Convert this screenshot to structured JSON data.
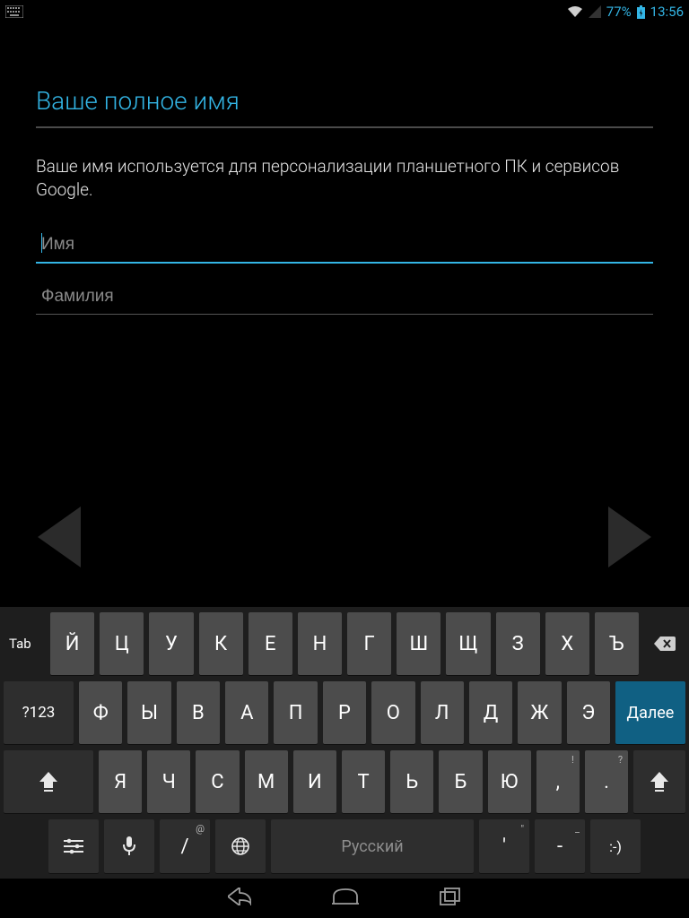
{
  "status": {
    "battery_pct": "77%",
    "clock": "13:56"
  },
  "form": {
    "title": "Ваше полное имя",
    "description": "Ваше имя используется для персонализации планшетного ПК и сервисов Google.",
    "first_name_placeholder": "Имя",
    "last_name_placeholder": "Фамилия",
    "first_name_value": "",
    "last_name_value": ""
  },
  "keyboard": {
    "tab": "Tab",
    "sym": "?123",
    "next": "Далее",
    "space": "Русский",
    "row1": [
      "Й",
      "Ц",
      "У",
      "К",
      "Е",
      "Н",
      "Г",
      "Ш",
      "Щ",
      "З",
      "Х",
      "Ъ"
    ],
    "row2": [
      "Ф",
      "Ы",
      "В",
      "А",
      "П",
      "Р",
      "О",
      "Л",
      "Д",
      "Ж",
      "Э"
    ],
    "row3": [
      "Я",
      "Ч",
      "С",
      "М",
      "И",
      "Т",
      "Ь",
      "Б",
      "Ю",
      ",",
      "."
    ],
    "row3_sup": {
      "9": "!",
      "10": "?"
    },
    "row4": {
      "slash": "/",
      "slash_sup": "@",
      "quote": "'",
      "quote_sup": "\"",
      "dash": "-",
      "dash_sup": "_",
      "smile": ":-)"
    }
  }
}
